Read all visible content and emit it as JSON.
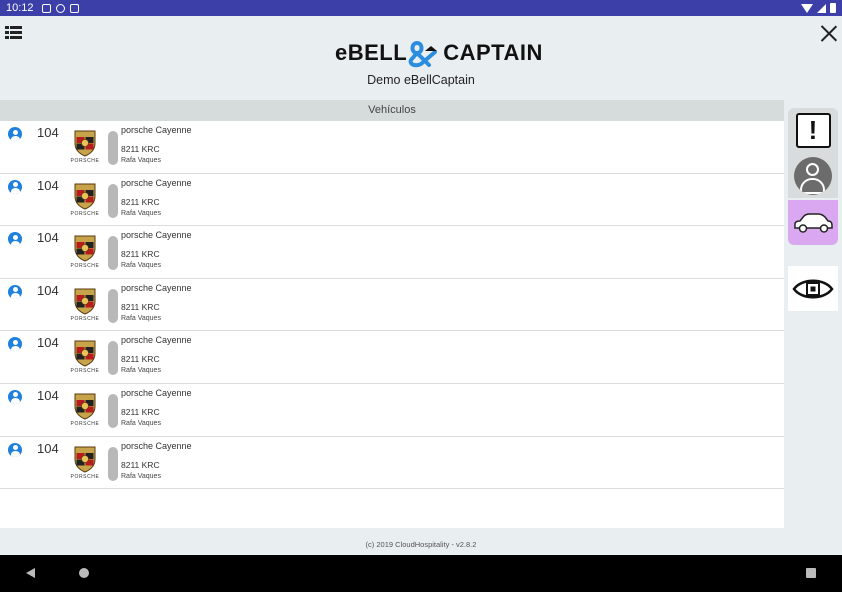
{
  "statusbar": {
    "time": "10:12"
  },
  "header": {
    "logo_left": "eBELL",
    "logo_right": "CAPTAIN",
    "subtitle": "Demo eBellCaptain"
  },
  "list": {
    "section_title": "Vehículos",
    "rows": [
      {
        "number": "104",
        "model": "porsche Cayenne",
        "plate": "8211 KRC",
        "driver": "Rafa Vaques"
      },
      {
        "number": "104",
        "model": "porsche Cayenne",
        "plate": "8211 KRC",
        "driver": "Rafa Vaques"
      },
      {
        "number": "104",
        "model": "porsche Cayenne",
        "plate": "8211 KRC",
        "driver": "Rafa Vaques"
      },
      {
        "number": "104",
        "model": "porsche Cayenne",
        "plate": "8211 KRC",
        "driver": "Rafa Vaques"
      },
      {
        "number": "104",
        "model": "porsche Cayenne",
        "plate": "8211 KRC",
        "driver": "Rafa Vaques"
      },
      {
        "number": "104",
        "model": "porsche Cayenne",
        "plate": "8211 KRC",
        "driver": "Rafa Vaques"
      },
      {
        "number": "104",
        "model": "porsche Cayenne",
        "plate": "8211 KRC",
        "driver": "Rafa Vaques"
      }
    ]
  },
  "sidebar": {
    "alert_symbol": "!",
    "icons": [
      "alert-icon",
      "person-icon",
      "car-icon",
      "eye-icon"
    ],
    "active_color": "#d9a8f0"
  },
  "brand": {
    "name": "PORSCHE"
  },
  "footer": {
    "text": "(c) 2019 CloudHospitality - v2.8.2"
  },
  "colors": {
    "statusbar": "#3c3fa8",
    "user_icon": "#1f80dd",
    "active_tab": "#d9a8f0"
  }
}
